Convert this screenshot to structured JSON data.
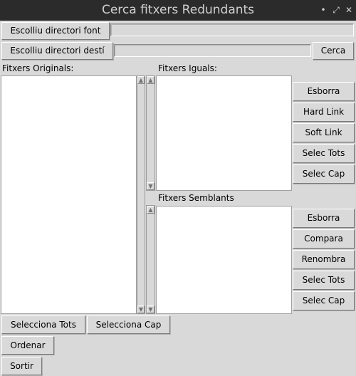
{
  "window": {
    "title": "Cerca fitxers Redundants",
    "controls": {
      "close": "✕",
      "maximize": "⤢",
      "minimize": "•"
    }
  },
  "top": {
    "source_button": "Escolliu directori font",
    "source_path": "",
    "dest_button": "Escolliu directori destí",
    "dest_path": "",
    "search_button": "Cerca"
  },
  "originals": {
    "label": "Fitxers Originals:",
    "items": []
  },
  "identical": {
    "label": "Fitxers Iguals:",
    "items": [],
    "buttons": {
      "delete": "Esborra",
      "hard_link": "Hard Link",
      "soft_link": "Soft Link",
      "select_all": "Selec Tots",
      "select_none": "Selec Cap"
    }
  },
  "similar": {
    "label": "Fitxers Semblants",
    "items": [],
    "buttons": {
      "delete": "Esborra",
      "compare": "Compara",
      "rename": "Renombra",
      "select_all": "Selec Tots",
      "select_none": "Selec Cap"
    }
  },
  "bottom": {
    "select_all": "Selecciona Tots",
    "select_none": "Selecciona Cap",
    "sort": "Ordenar",
    "exit": "Sortir"
  },
  "icons": {
    "scroll_up": "▲",
    "scroll_down": "▼"
  }
}
